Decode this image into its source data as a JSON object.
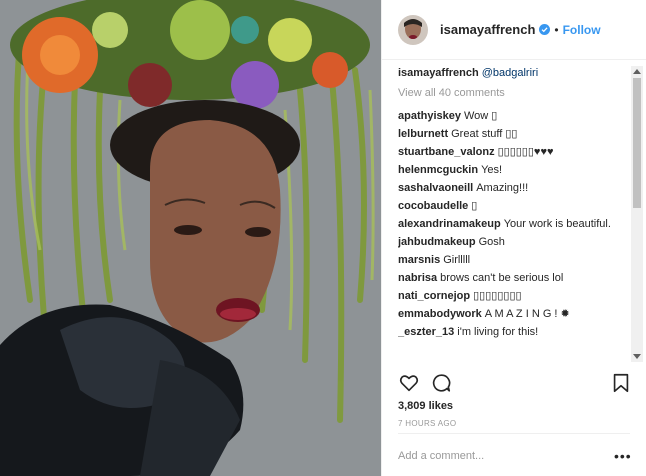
{
  "post": {
    "username": "isamayaffrench",
    "follow_label": "Follow",
    "dot": "•",
    "caption_user": "isamayaffrench",
    "caption_mention": "@badgalriri",
    "view_all": "View all 40 comments",
    "comments": [
      {
        "user": "apathyiskey",
        "text": "Wow ▯"
      },
      {
        "user": "lelburnett",
        "text": "Great stuff ▯▯"
      },
      {
        "user": "stuartbane_valonz",
        "text": "▯▯▯▯▯▯♥♥♥"
      },
      {
        "user": "helenmcguckin",
        "text": "Yes!"
      },
      {
        "user": "sashalvaoneill",
        "text": "Amazing!!!"
      },
      {
        "user": "cocobaudelle",
        "text": "▯"
      },
      {
        "user": "alexandrinamakeup",
        "text": "Your work is beautiful."
      },
      {
        "user": "jahbudmakeup",
        "text": "Gosh"
      },
      {
        "user": "marsnis",
        "text": "Girlllll"
      },
      {
        "user": "nabrisa",
        "text": "brows can't be serious lol"
      },
      {
        "user": "nati_cornejop",
        "text": "▯▯▯▯▯▯▯▯"
      },
      {
        "user": "emmabodywork",
        "text": "A M A Z I N G ! ✹"
      },
      {
        "user": "_eszter_13",
        "text": "i'm living for this!"
      }
    ],
    "likes": "3,809 likes",
    "time": "7 HOURS AGO",
    "add_comment_placeholder": "Add a comment...",
    "more": "•••"
  },
  "colors": {
    "link": "#3897f0",
    "verified": "#3897f0"
  },
  "icons": [
    "verified-badge-icon",
    "heart-icon",
    "comment-icon",
    "bookmark-icon",
    "more-options-icon"
  ]
}
